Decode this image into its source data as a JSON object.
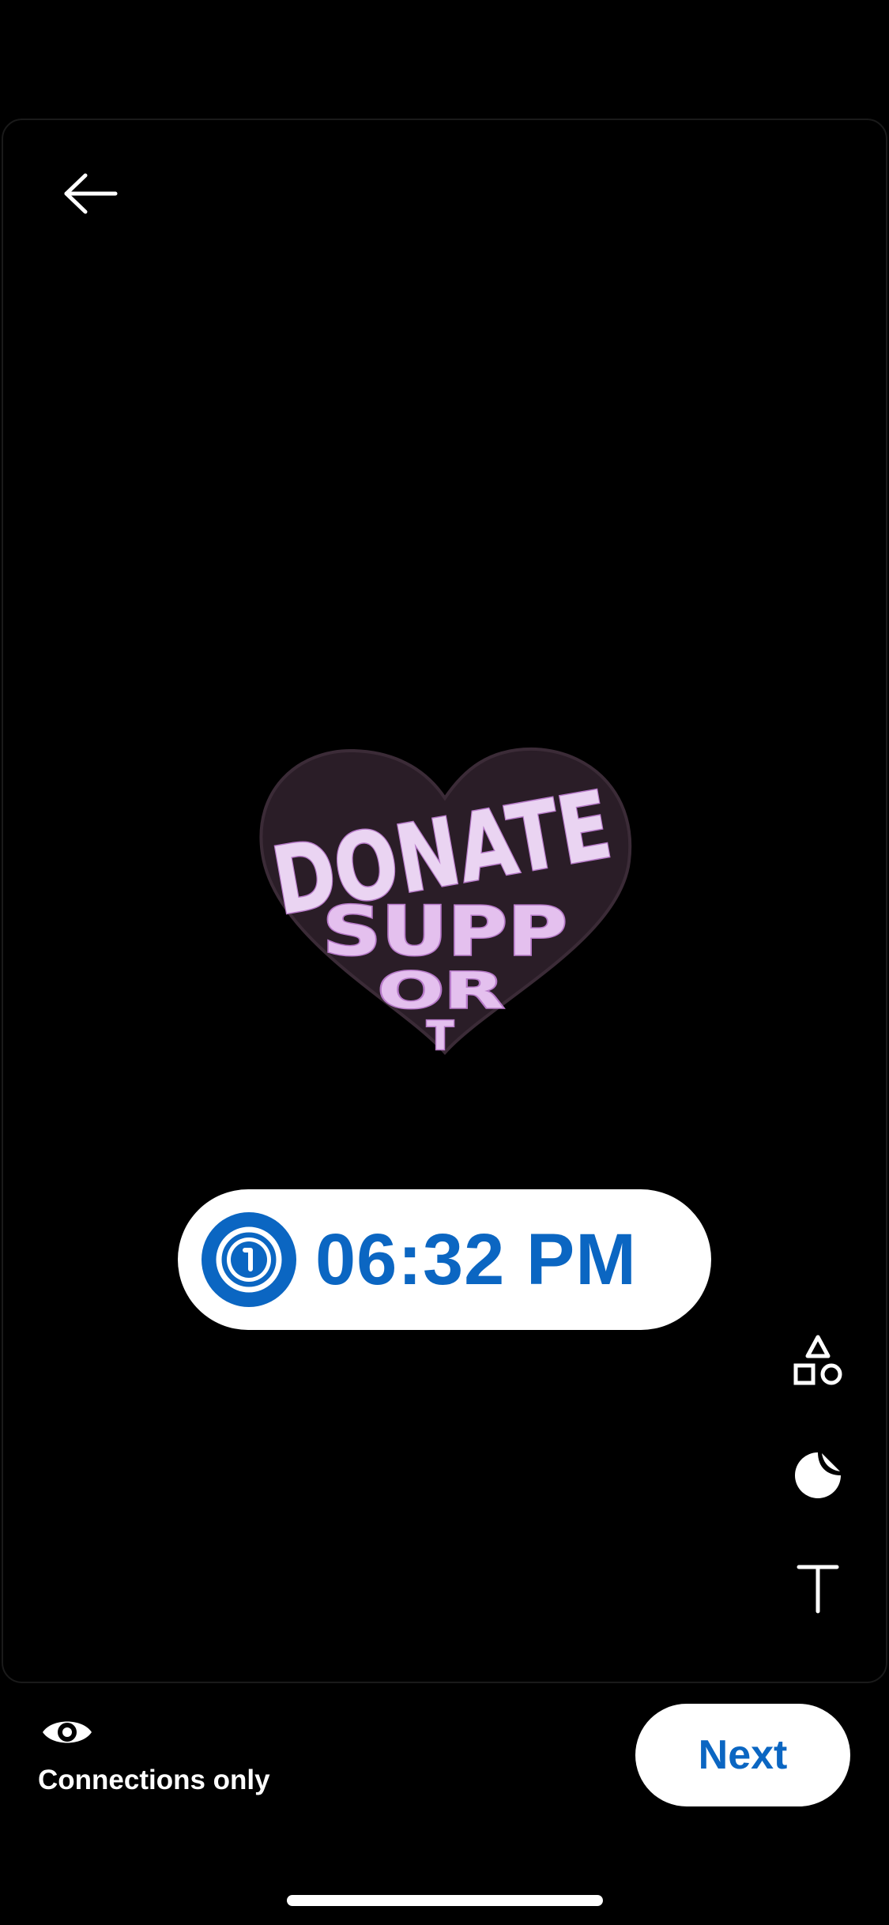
{
  "header": {
    "back_icon": "arrow-left-icon"
  },
  "canvas": {
    "sticker": {
      "type": "heart-sticker",
      "lines": [
        "DONATE",
        "SUPP",
        "OR",
        "T"
      ],
      "colors": {
        "heart": "#2a1d27",
        "letters": "#d9b7e8",
        "outline": "#c585d4"
      }
    },
    "time_sticker": {
      "icon": "clock-icon",
      "time": "06:32 PM",
      "color": "#0b66c2"
    }
  },
  "tools": [
    {
      "name": "shapes",
      "icon": "shapes-icon"
    },
    {
      "name": "stickers",
      "icon": "sticker-icon"
    },
    {
      "name": "text",
      "icon": "text-icon"
    }
  ],
  "footer": {
    "visibility_icon": "eye-icon",
    "visibility_label": "Connections only",
    "next_label": "Next"
  },
  "colors": {
    "background": "#000000",
    "accent": "#0b66c2",
    "pill_bg": "#ffffff"
  }
}
